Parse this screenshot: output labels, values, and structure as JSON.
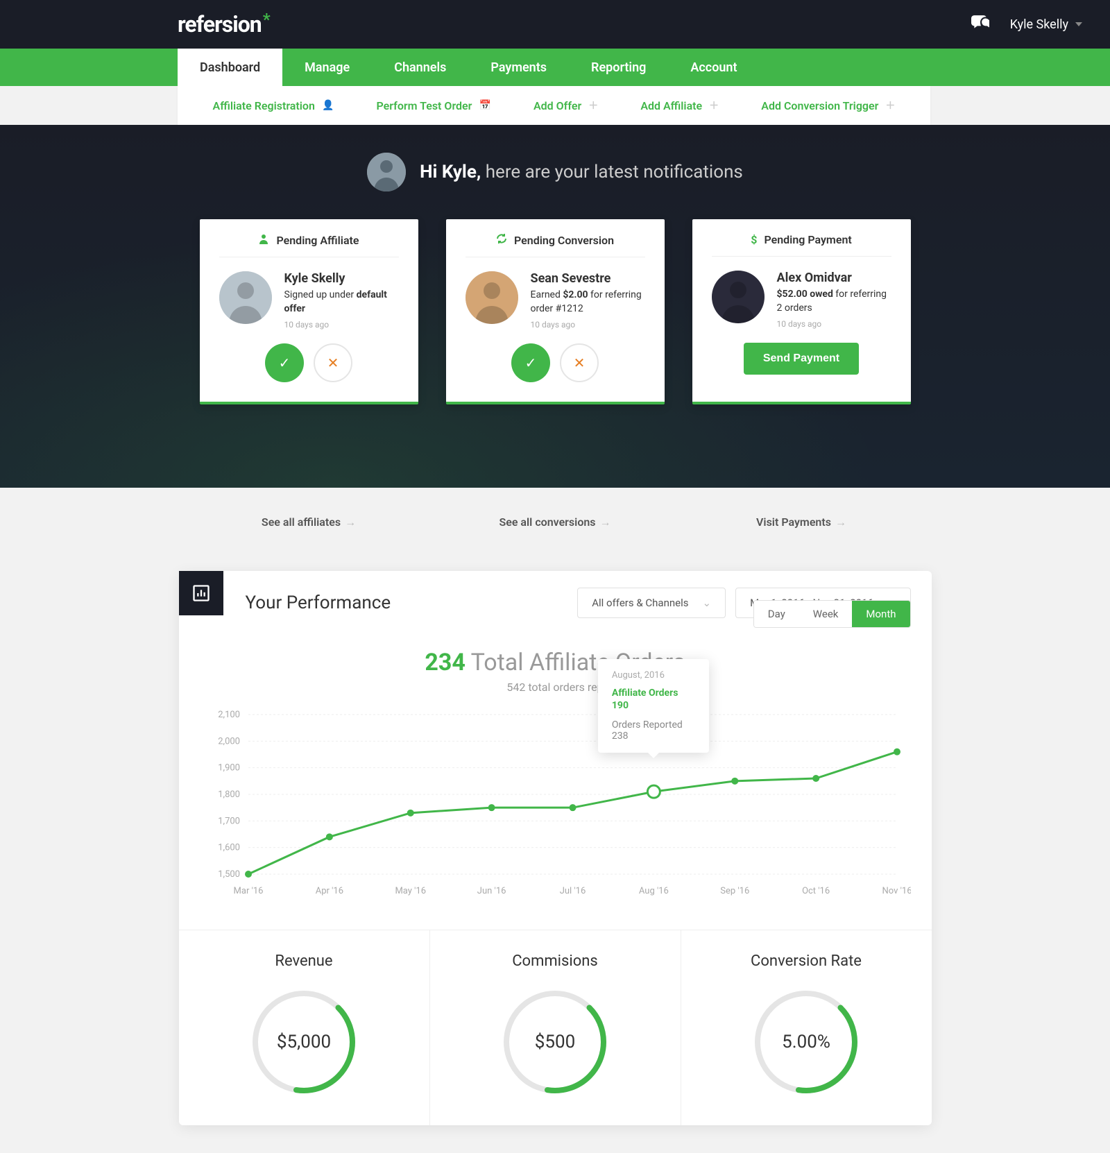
{
  "brand": "refersion",
  "user": {
    "name": "Kyle Skelly"
  },
  "nav": {
    "tabs": [
      "Dashboard",
      "Manage",
      "Channels",
      "Payments",
      "Reporting",
      "Account"
    ],
    "active": 0
  },
  "subnav": [
    {
      "label": "Affiliate Registration",
      "icon": "user"
    },
    {
      "label": "Perform Test Order",
      "icon": "calendar"
    },
    {
      "label": "Add Offer",
      "icon": "plus"
    },
    {
      "label": "Add Affiliate",
      "icon": "plus"
    },
    {
      "label": "Add Conversion Trigger",
      "icon": "plus"
    }
  ],
  "greeting": {
    "hi": "Hi Kyle,",
    "rest": "here are your latest notifications"
  },
  "cards": [
    {
      "title": "Pending Affiliate",
      "icon": "user",
      "name": "Kyle Skelly",
      "desc_pre": "Signed up under ",
      "desc_bold": "default offer",
      "desc_post": "",
      "time": "10 days ago",
      "actions": "approve_reject",
      "see": "See all affiliates"
    },
    {
      "title": "Pending Conversion",
      "icon": "refresh",
      "name": "Sean Sevestre",
      "desc_pre": "Earned ",
      "desc_bold": "$2.00",
      "desc_post": " for referring order #1212",
      "time": "10 days ago",
      "actions": "approve_reject",
      "see": "See all conversions"
    },
    {
      "title": "Pending Payment",
      "icon": "dollar",
      "name": "Alex Omidvar",
      "desc_pre": "",
      "desc_bold": "$52.00 owed",
      "desc_post": " for referring 2 orders",
      "time": "10 days ago",
      "actions": "send_payment",
      "button": "Send Payment",
      "see": "Visit Payments"
    }
  ],
  "performance": {
    "title": "Your Performance",
    "filter1": "All offers & Channels",
    "filter2": "Mar 1, 2016 - Nov 31, 2016",
    "total_num": "234",
    "total_label": "Total Affiliate Orders",
    "subtitle": "542 total orders rep",
    "periods": [
      "Day",
      "Week",
      "Month"
    ],
    "active_period": 2,
    "tooltip": {
      "date": "August, 2016",
      "main": "Affiliate Orders",
      "main_val": "190",
      "sec": "Orders Reported",
      "sec_val": "238"
    }
  },
  "chart_data": {
    "type": "line",
    "categories": [
      "Mar '16",
      "Apr '16",
      "May '16",
      "Jun '16",
      "Jul '16",
      "Aug '16",
      "Sep '16",
      "Oct '16",
      "Nov '16"
    ],
    "values": [
      1500,
      1640,
      1730,
      1750,
      1750,
      1810,
      1850,
      1860,
      1960
    ],
    "xlabel": "",
    "ylabel": "",
    "ylim": [
      1500,
      2100
    ],
    "yticks": [
      1500,
      1600,
      1700,
      1800,
      1900,
      2000,
      2100
    ],
    "highlight_index": 5
  },
  "metrics": [
    {
      "title": "Revenue",
      "value": "$5,000",
      "pct": 40
    },
    {
      "title": "Commisions",
      "value": "$500",
      "pct": 40
    },
    {
      "title": "Conversion Rate",
      "value": "5.00%",
      "pct": 40
    }
  ]
}
